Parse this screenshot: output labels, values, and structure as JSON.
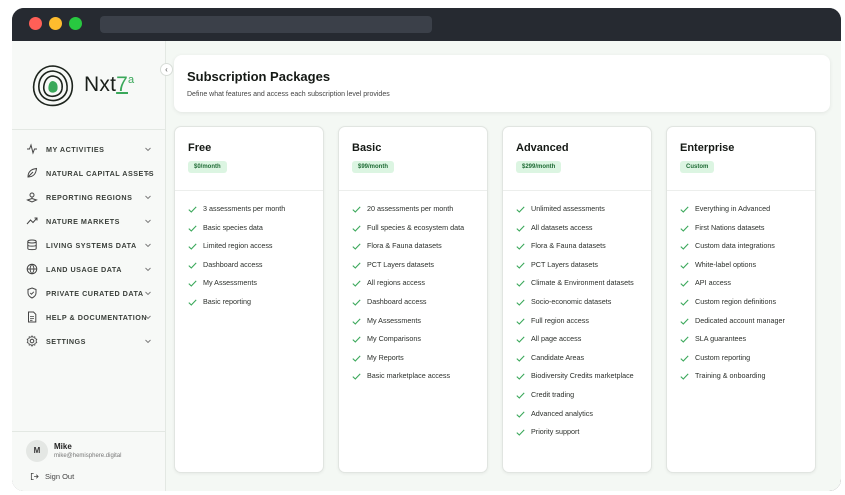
{
  "brand": {
    "name": "Nxt",
    "name_accent": "7",
    "name_sup": "a"
  },
  "sidebar": {
    "collapse_icon": "chevron-left-icon",
    "items": [
      {
        "label": "MY ACTIVITIES",
        "icon": "activity-icon"
      },
      {
        "label": "NATURAL CAPITAL ASSETS",
        "icon": "leaf-icon"
      },
      {
        "label": "REPORTING REGIONS",
        "icon": "map-pin-icon"
      },
      {
        "label": "NATURE MARKETS",
        "icon": "trend-icon"
      },
      {
        "label": "LIVING SYSTEMS DATA",
        "icon": "database-icon"
      },
      {
        "label": "LAND USAGE DATA",
        "icon": "globe-icon"
      },
      {
        "label": "PRIVATE CURATED DATA",
        "icon": "shield-icon"
      },
      {
        "label": "HELP & DOCUMENTATION",
        "icon": "document-icon"
      },
      {
        "label": "SETTINGS",
        "icon": "gear-icon"
      }
    ]
  },
  "user": {
    "initial": "M",
    "name": "Mike",
    "email": "mike@hemisphere.digital",
    "signout_label": "Sign Out"
  },
  "header": {
    "title": "Subscription Packages",
    "subtitle": "Define what features and access each subscription level provides"
  },
  "plans": [
    {
      "name": "Free",
      "price": "$0/month",
      "features": [
        "3 assessments per month",
        "Basic species data",
        "Limited region access",
        "Dashboard access",
        "My Assessments",
        "Basic reporting"
      ]
    },
    {
      "name": "Basic",
      "price": "$99/month",
      "features": [
        "20 assessments per month",
        "Full species & ecosystem data",
        "Flora & Fauna datasets",
        "PCT Layers datasets",
        "All regions access",
        "Dashboard access",
        "My Assessments",
        "My Comparisons",
        "My Reports",
        "Basic marketplace access"
      ]
    },
    {
      "name": "Advanced",
      "price": "$299/month",
      "features": [
        "Unlimited assessments",
        "All datasets access",
        "Flora & Fauna datasets",
        "PCT Layers datasets",
        "Climate & Environment datasets",
        "Socio-economic datasets",
        "Full region access",
        "All page access",
        "Candidate Areas",
        "Biodiversity Credits marketplace",
        "Credit trading",
        "Advanced analytics",
        "Priority support"
      ]
    },
    {
      "name": "Enterprise",
      "price": "Custom",
      "features": [
        "Everything in Advanced",
        "First Nations datasets",
        "Custom data integrations",
        "White-label options",
        "API access",
        "Custom region definitions",
        "Dedicated account manager",
        "SLA guarantees",
        "Custom reporting",
        "Training & onboarding"
      ]
    }
  ],
  "colors": {
    "accent": "#3aa85a",
    "badge_bg": "#dcf5e2",
    "badge_text": "#1f6b35",
    "check": "#3aa85a"
  }
}
